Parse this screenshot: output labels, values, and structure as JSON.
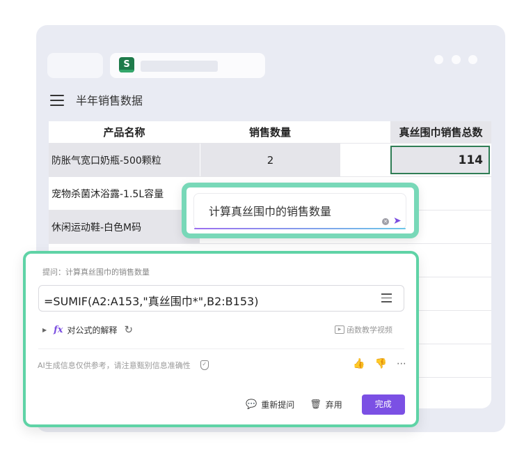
{
  "sheet_title": "半年销售数据",
  "table": {
    "headers": [
      "产品名称",
      "销售数量",
      "",
      "真丝围巾销售总数"
    ],
    "rows": [
      [
        "防胀气宽口奶瓶-500颗粒",
        "2",
        "",
        "114"
      ],
      [
        "宠物杀菌沐浴露-1.5L容量",
        "",
        "",
        ""
      ],
      [
        "休闲运动鞋-白色M码",
        "",
        "",
        ""
      ]
    ]
  },
  "query_input": {
    "text": "计算真丝围巾的销售数量"
  },
  "panel": {
    "prompt_label": "提问：计算真丝围巾的销售数量",
    "formula": "=SUMIF(A2:A153,\"真丝围巾*\",B2:B153)",
    "explain_label": "对公式的解释",
    "video_label": "函数教学视频",
    "ai_note": "AI生成信息仅供参考，请注意甄别信息准确性",
    "regenerate_label": "重新提问",
    "discard_label": "弃用",
    "done_label": "完成"
  },
  "colors": {
    "accent_green": "#5fd3a6",
    "accent_purple": "#7b50e4",
    "sheets_green": "#1e7a4a"
  }
}
